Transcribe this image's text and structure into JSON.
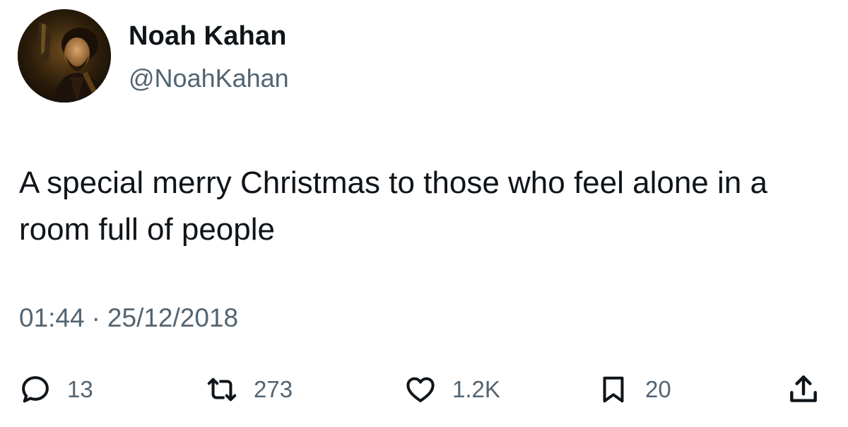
{
  "author": {
    "display_name": "Noah Kahan",
    "handle": "@NoahKahan"
  },
  "tweet": {
    "text": "A special merry Christmas to those who feel alone in a room full of people",
    "time": "01:44",
    "separator": "·",
    "date": "25/12/2018"
  },
  "actions": {
    "replies": "13",
    "retweets": "273",
    "likes": "1.2K",
    "bookmarks": "20"
  },
  "icons": {
    "reply": "reply-icon",
    "retweet": "retweet-icon",
    "like": "heart-icon",
    "bookmark": "bookmark-icon",
    "share": "share-icon"
  },
  "colors": {
    "primary_text": "#0f1419",
    "secondary_text": "#536471",
    "background": "#ffffff"
  }
}
